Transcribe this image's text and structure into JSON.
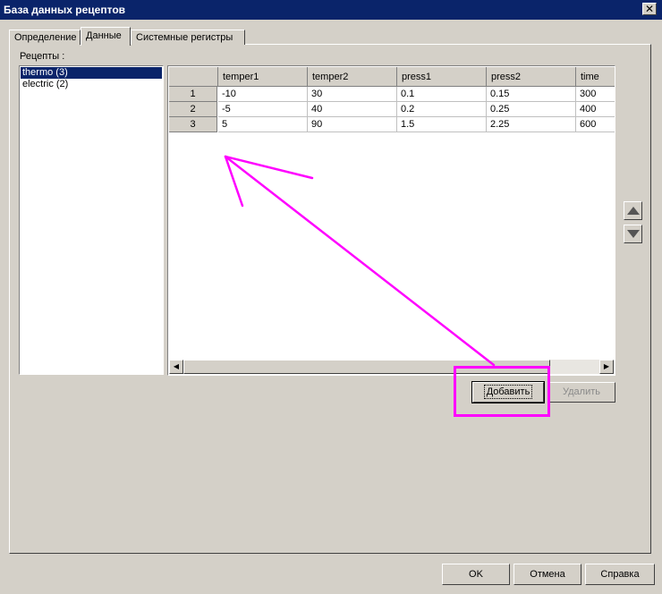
{
  "window": {
    "title": "База данных рецептов",
    "close_glyph": "✕"
  },
  "tabs": [
    {
      "label": "Определение",
      "active": false
    },
    {
      "label": "Данные",
      "active": true
    },
    {
      "label": "Системные регистры",
      "active": false
    }
  ],
  "recipes": {
    "label": "Рецепты :",
    "items": [
      {
        "label": "thermo (3)",
        "selected": true
      },
      {
        "label": "electric (2)",
        "selected": false
      }
    ]
  },
  "grid": {
    "columns": [
      "temper1",
      "temper2",
      "press1",
      "press2",
      "time"
    ],
    "rows": [
      {
        "index": "1",
        "cells": [
          "-10",
          "30",
          "0.1",
          "0.15",
          "300"
        ]
      },
      {
        "index": "2",
        "cells": [
          "-5",
          "40",
          "0.2",
          "0.25",
          "400"
        ]
      },
      {
        "index": "3",
        "cells": [
          "5",
          "90",
          "1.5",
          "2.25",
          "600"
        ]
      }
    ]
  },
  "actions": {
    "add": "Добавить",
    "delete": "Удалить"
  },
  "footer": {
    "ok": "OK",
    "cancel": "Отмена",
    "help": "Справка"
  },
  "colors": {
    "annotation": "#ff00ff",
    "selection": "#0a246a",
    "face": "#d4d0c8"
  },
  "icons": {
    "move_up": "up-arrow-icon",
    "move_down": "down-arrow-icon"
  }
}
